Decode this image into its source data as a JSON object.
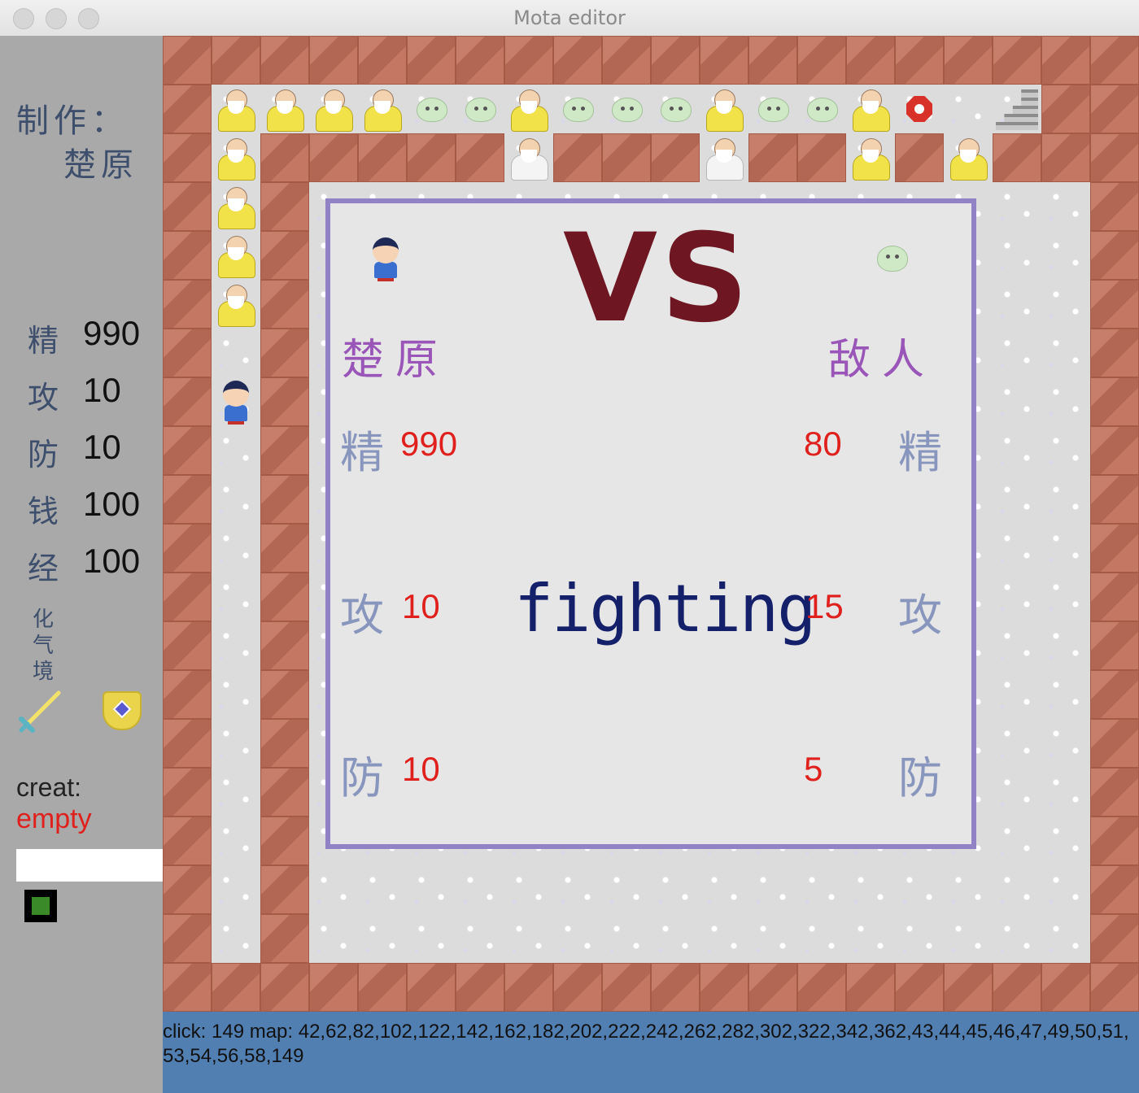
{
  "window": {
    "title": "Mota editor"
  },
  "sidebar": {
    "credit_label": "制作：",
    "credit_name": "楚原",
    "stats": [
      {
        "glyph": "精",
        "value": "990"
      },
      {
        "glyph": "攻",
        "value": "10"
      },
      {
        "glyph": "防",
        "value": "10"
      },
      {
        "glyph": "钱",
        "value": "100"
      },
      {
        "glyph": "经",
        "value": "100"
      }
    ],
    "realm": "化气境",
    "inventory": [
      {
        "icon": "sword-icon"
      },
      {
        "icon": "shield-icon"
      }
    ],
    "creat_label": "creat:",
    "creat_value": "empty",
    "creat_input_value": "",
    "swatch_color": "#3a8a2a"
  },
  "battle": {
    "vs_label": "VS",
    "hero_name": "楚原",
    "enemy_name": "敌人",
    "stat_labels": [
      "精",
      "攻",
      "防"
    ],
    "hero_stats": [
      "990",
      "10",
      "10"
    ],
    "enemy_stats": [
      "80",
      "15",
      "5"
    ],
    "status_text": "fighting"
  },
  "status": {
    "text": "click: 149 map: 42,62,82,102,122,142,162,182,202,222,242,262,282,302,322,342,362,43,44,45,46,47,49,50,51,53,54,56,58,149"
  },
  "colors": {
    "wall": "#c0705a",
    "floor": "#dcdcdc",
    "panel_border": "#9082c4",
    "stat_value": "#e0201c",
    "statusbar": "#527fb2"
  }
}
